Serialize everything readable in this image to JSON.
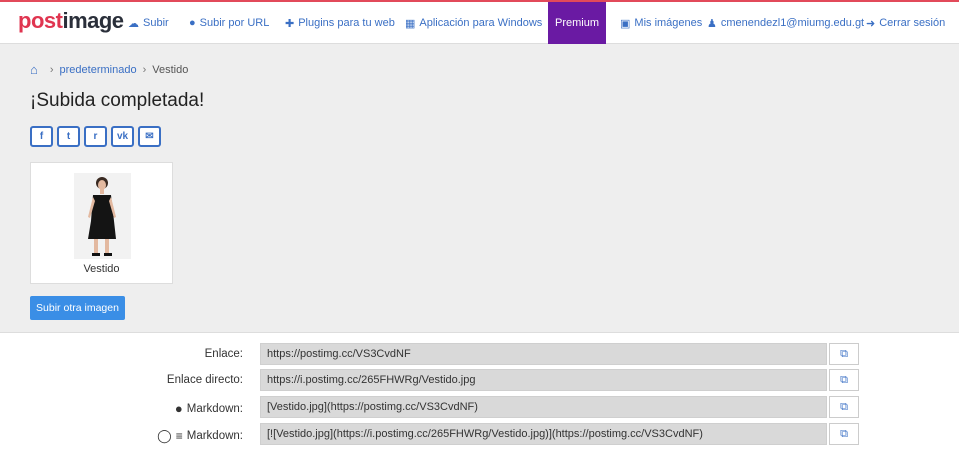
{
  "nav": {
    "logo_a": "post",
    "logo_b": "image",
    "items": [
      {
        "icon": "cloud-upload-icon",
        "glyph": "☁",
        "label": "Subir"
      },
      {
        "icon": "globe-icon",
        "glyph": "●",
        "label": "Subir por URL"
      },
      {
        "icon": "plugin-icon",
        "glyph": "✚",
        "label": "Plugins para tu web"
      },
      {
        "icon": "windows-icon",
        "glyph": "▦",
        "label": "Aplicación para Windows"
      },
      {
        "icon": "image-icon",
        "glyph": "▣",
        "label": "Mis imágenes"
      },
      {
        "icon": "user-icon",
        "glyph": "♟",
        "label": "cmenendezl1@miumg.edu.gt"
      },
      {
        "icon": "sign-out-icon",
        "glyph": "➜",
        "label": "Cerrar sesión"
      }
    ],
    "premium": "Premium",
    "accent": "#e03550",
    "premium_color": "#6a1aa3"
  },
  "breadcrumb": {
    "home_icon": "home-icon",
    "folder": "predeterminado",
    "current": "Vestido"
  },
  "page_title": "¡Subida completada!",
  "share": [
    {
      "icon": "facebook-icon",
      "glyph": "f"
    },
    {
      "icon": "twitter-icon",
      "glyph": "t"
    },
    {
      "icon": "reddit-icon",
      "glyph": "r"
    },
    {
      "icon": "vk-icon",
      "glyph": "vk"
    },
    {
      "icon": "email-icon",
      "glyph": "✉"
    }
  ],
  "thumbnail": {
    "caption": "Vestido"
  },
  "upload_another": "Subir otra imagen",
  "links": [
    {
      "label": "Enlace:",
      "value": "https://postimg.cc/VS3CvdNF",
      "icons": []
    },
    {
      "label": "Enlace directo:",
      "value": "https://i.postimg.cc/265FHWRg/Vestido.jpg",
      "icons": []
    },
    {
      "label": "Markdown:",
      "value": "[Vestido.jpg](https://postimg.cc/VS3CvdNF)",
      "icons": [
        "reddit-icon"
      ]
    },
    {
      "label": "Markdown:",
      "value": "[![Vestido.jpg](https://i.postimg.cc/265FHWRg/Vestido.jpg)](https://postimg.cc/VS3CvdNF)",
      "icons": [
        "github-icon",
        "stackoverflow-icon"
      ]
    }
  ],
  "copy_icon": "copy-icon",
  "brand_blue": "#3a6fc4"
}
